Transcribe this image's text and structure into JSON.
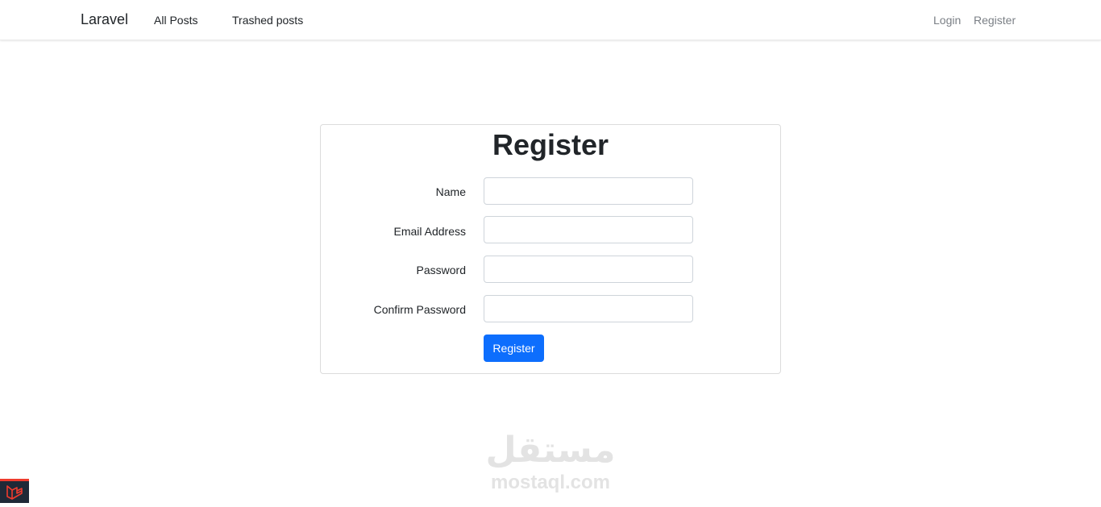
{
  "navbar": {
    "brand": "Laravel",
    "links": [
      "All Posts",
      "Trashed posts"
    ],
    "auth_links": [
      "Login",
      "Register"
    ]
  },
  "register_form": {
    "title": "Register",
    "fields": [
      {
        "label": "Name",
        "value": ""
      },
      {
        "label": "Email Address",
        "value": ""
      },
      {
        "label": "Password",
        "value": ""
      },
      {
        "label": "Confirm Password",
        "value": ""
      }
    ],
    "submit_label": "Register"
  },
  "watermark": {
    "arabic": "مستقل",
    "latin": "mostaql.com"
  },
  "debugbar": {
    "icon": "laravel-logo-icon",
    "accent": "#ef3b2d"
  },
  "colors": {
    "primary": "#0d6efd",
    "border": "#dcdcdc"
  }
}
